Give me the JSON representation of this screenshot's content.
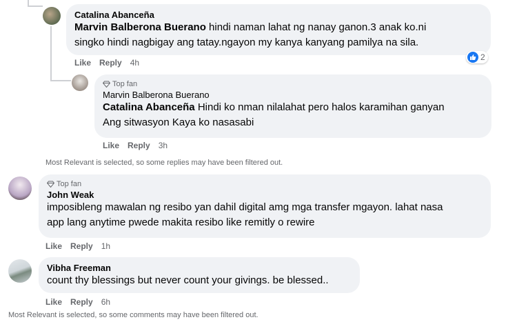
{
  "comments": [
    {
      "author": "Catalina Abanceña",
      "mention": "Marvin Balberona Buerano",
      "text_line1": " hindi naman lahat ng nanay ganon.3 anak ko.ni",
      "text_line2": "singko hindi nagbigay ang tatay.ngayon my kanya kanyang pamilya na sila.",
      "like_label": "Like",
      "reply_label": "Reply",
      "time": "4h",
      "reaction_count": "2"
    },
    {
      "badge": "Top fan",
      "author": "Marvin Balberona Buerano",
      "mention": "Catalina Abanceña",
      "text_line1": " Hindi ko nman nilalahat pero halos karamihan ganyan",
      "text_line2": "Ang sitwasyon Kaya ko nasasabi",
      "like_label": "Like",
      "reply_label": "Reply",
      "time": "3h"
    },
    {
      "badge": "Top fan",
      "author": "John Weak",
      "text_line1": "imposibleng mawalan ng resibo yan dahil digital amg mga transfer mgayon. lahat nasa",
      "text_line2": "app lang anytime pwede makita resibo like remitly o rewire",
      "like_label": "Like",
      "reply_label": "Reply",
      "time": "1h"
    },
    {
      "author": "Vibha Freeman",
      "text_line1": "count thy blessings but never count your givings. be blessed..",
      "like_label": "Like",
      "reply_label": "Reply",
      "time": "6h"
    }
  ],
  "notes": {
    "replies_filtered": "Most Relevant is selected, so some replies may have been filtered out.",
    "comments_filtered": "Most Relevant is selected, so some comments may have been filtered out."
  },
  "colors": {
    "bubble": "#f0f2f5",
    "secondary_text": "#65676b",
    "like_blue": "#1877f2"
  }
}
